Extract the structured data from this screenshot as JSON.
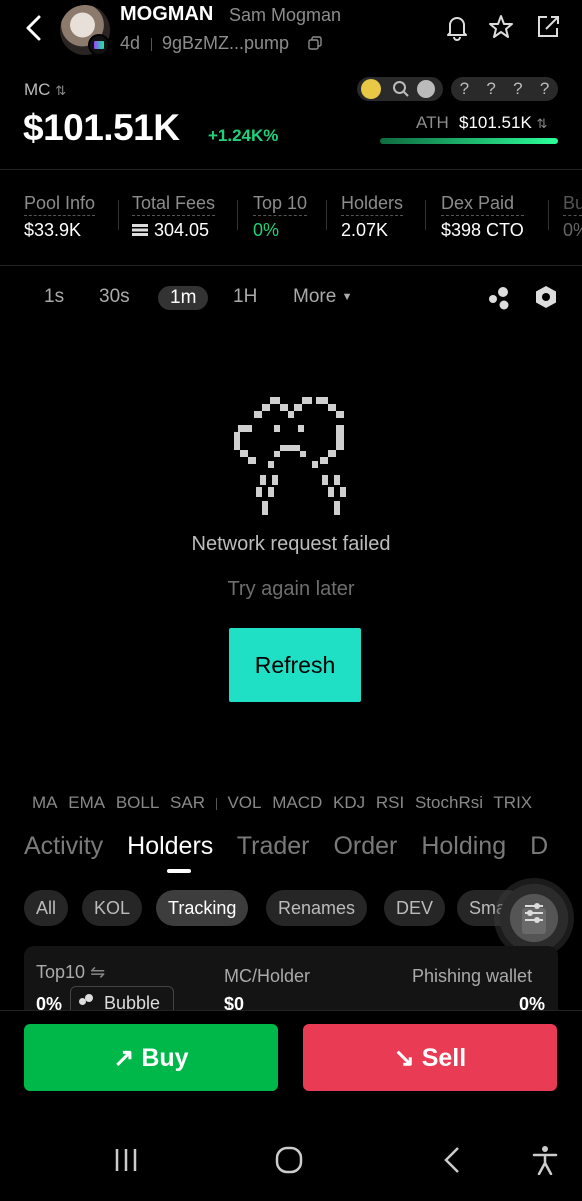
{
  "token": {
    "ticker": "MOGMAN",
    "name": "Sam Mogman",
    "age": "4d",
    "address": "9gBzMZ...pump"
  },
  "market": {
    "mc_label": "MC",
    "mc_value": "$101.51K",
    "mc_change": "+1.24K%",
    "ath_label": "ATH",
    "ath_value": "$101.51K",
    "tags": [
      "?",
      "?",
      "?",
      "?"
    ]
  },
  "stats": [
    {
      "label": "Pool Info",
      "value": "$33.9K"
    },
    {
      "label": "Total Fees",
      "value": "304.05"
    },
    {
      "label": "Top 10",
      "value": "0%"
    },
    {
      "label": "Holders",
      "value": "2.07K"
    },
    {
      "label": "Dex Paid",
      "value": "$398 CTO"
    },
    {
      "label": "Bu",
      "value": "0%"
    }
  ],
  "timeframes": [
    "1s",
    "30s",
    "1m",
    "1H"
  ],
  "timeframe_active": "1m",
  "more_label": "More",
  "error": {
    "title": "Network request failed",
    "subtitle": "Try again later",
    "button": "Refresh"
  },
  "indicators": [
    "MA",
    "EMA",
    "BOLL",
    "SAR",
    "VOL",
    "MACD",
    "KDJ",
    "RSI",
    "StochRsi",
    "TRIX"
  ],
  "tabs": [
    "Activity",
    "Holders",
    "Trader",
    "Order",
    "Holding",
    "D"
  ],
  "tab_active": "Holders",
  "filters": [
    "All",
    "KOL",
    "Tracking",
    "Renames",
    "DEV",
    "Sma"
  ],
  "filter_active": "Tracking",
  "holder_card": {
    "top10_label": "Top10",
    "top10_value": "0%",
    "bubble_label": "Bubble",
    "mc_holder_label": "MC/Holder",
    "mc_holder_value": "$0",
    "phishing_label": "Phishing wallet",
    "phishing_value": "0%"
  },
  "actions": {
    "buy": "Buy",
    "sell": "Sell"
  },
  "colors": {
    "accent": "#1fe0c4",
    "buy": "#00b84a",
    "sell": "#ea3b55",
    "positive": "#1fd17a"
  }
}
